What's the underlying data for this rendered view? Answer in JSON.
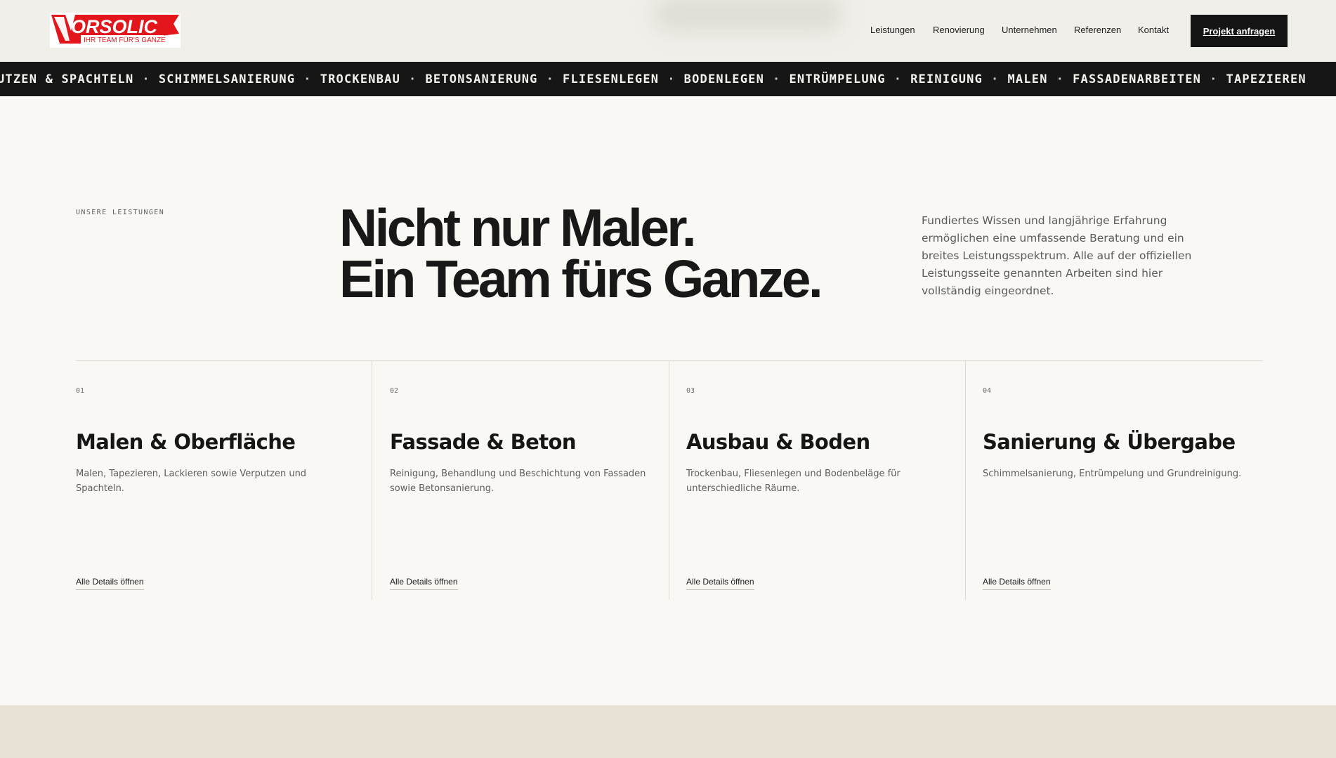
{
  "brand": {
    "logo_text": "ORSOLIC",
    "logo_tagline": "IHR TEAM FÜR'S GANZE",
    "logo_color": "#e2161b"
  },
  "nav": {
    "items": [
      {
        "label": "Leistungen"
      },
      {
        "label": "Renovierung"
      },
      {
        "label": "Unternehmen"
      },
      {
        "label": "Referenzen"
      },
      {
        "label": "Kontakt"
      }
    ],
    "cta_label": "Projekt anfragen"
  },
  "ticker": {
    "items": [
      "UTZEN & SPACHTELN",
      "SCHIMMELSANIERUNG",
      "TROCKENBAU",
      "BETONSANIERUNG",
      "FLIESENLEGEN",
      "BODENLEGEN",
      "ENTRÜMPELUNG",
      "REINIGUNG",
      "MALEN",
      "FASSADENARBEITEN",
      "TAPEZIEREN"
    ],
    "separator": "·"
  },
  "intro": {
    "eyebrow": "UNSERE LEISTUNGEN",
    "headline_line1": "Nicht nur Maler.",
    "headline_line2": "Ein Team fürs Ganze.",
    "text": "Fundiertes Wissen und langjährige Erfahrung ermöglichen eine umfassende Beratung und ein breites Leistungsspektrum. Alle auf der offiziellen Leistungsseite genannten Arbeiten sind hier vollständig eingeordnet."
  },
  "cards": [
    {
      "num": "01",
      "title": "Malen & Oberfläche",
      "desc": "Malen, Tapezieren, Lackieren sowie Verputzen und Spachteln.",
      "link": "Alle Details öffnen"
    },
    {
      "num": "02",
      "title": "Fassade & Beton",
      "desc": "Reinigung, Behandlung und Beschichtung von Fassaden sowie Betonsanierung.",
      "link": "Alle Details öffnen"
    },
    {
      "num": "03",
      "title": "Ausbau & Boden",
      "desc": "Trockenbau, Fliesenlegen und Bodenbeläge für unterschiedliche Räume.",
      "link": "Alle Details öffnen"
    },
    {
      "num": "04",
      "title": "Sanierung & Übergabe",
      "desc": "Schimmelsanierung, Entrümpelung und Grundreinigung.",
      "link": "Alle Details öffnen"
    }
  ]
}
